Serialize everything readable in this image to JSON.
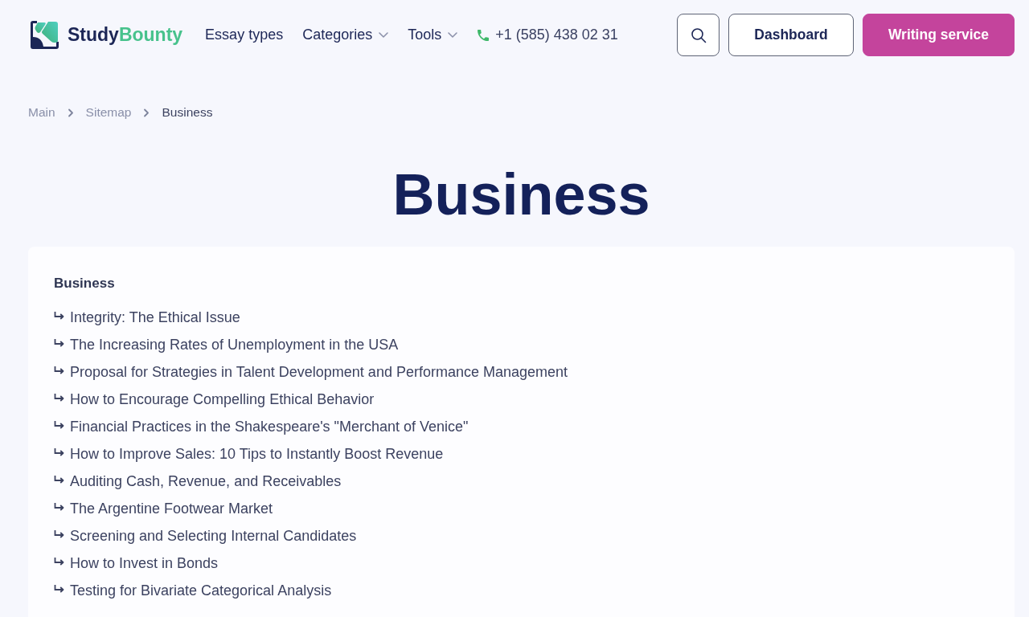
{
  "header": {
    "logo": {
      "brand_first": "Study",
      "brand_second": "Bounty"
    },
    "nav": [
      {
        "label": "Essay types",
        "kind": "link"
      },
      {
        "label": "Categories",
        "kind": "dropdown"
      },
      {
        "label": "Tools",
        "kind": "dropdown"
      },
      {
        "label": "+1 (585) 438 02 31",
        "kind": "phone"
      }
    ],
    "buttons": [
      {
        "label": "Dashboard",
        "kind": "outline"
      },
      {
        "label": "Writing service",
        "kind": "primary"
      }
    ]
  },
  "breadcrumb": [
    {
      "label": "Main",
      "current": false
    },
    {
      "label": "Sitemap",
      "current": false
    },
    {
      "label": "Business",
      "current": true
    }
  ],
  "page_title": "Business",
  "card": {
    "heading": "Business",
    "items": [
      "Integrity: The Ethical Issue",
      "The Increasing Rates of Unemployment in the USA",
      "Proposal for Strategies in Talent Development and Performance Management",
      "How to Encourage Compelling Ethical Behavior",
      "Financial Practices in the Shakespeare's \"Merchant of Venice\"",
      "How to Improve Sales: 10 Tips to Instantly Boost Revenue",
      "Auditing Cash, Revenue, and Receivables",
      "The Argentine Footwear Market",
      "Screening and Selecting Internal Candidates",
      "How to Invest in Bonds",
      "Testing for Bivariate Categorical Analysis"
    ]
  }
}
